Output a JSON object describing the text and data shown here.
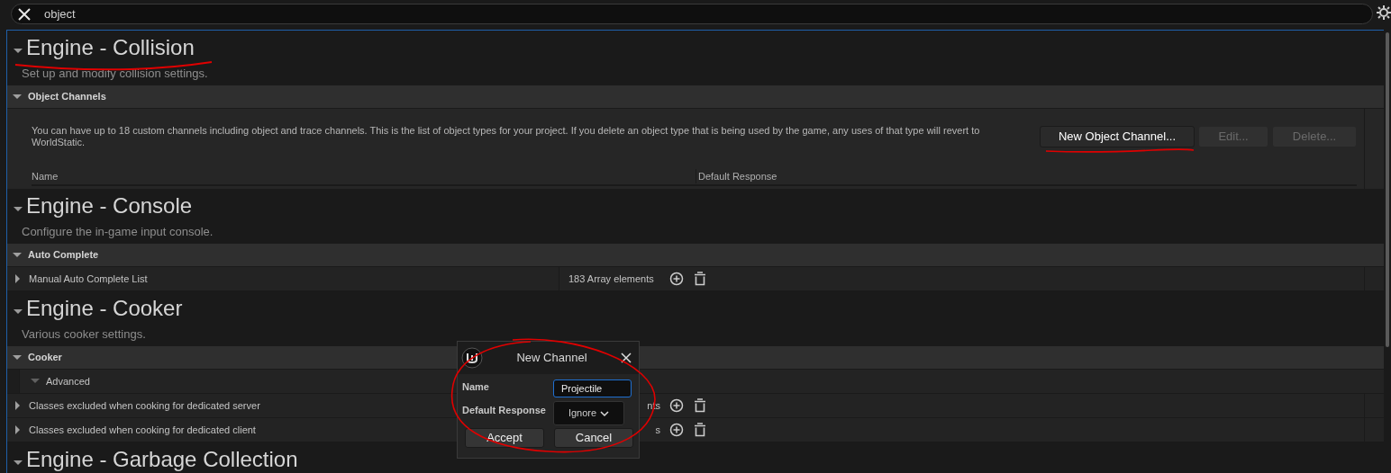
{
  "search": {
    "value": "object"
  },
  "sections": [
    {
      "title": "Engine - Collision",
      "description": "Set up and modify collision settings.",
      "expanded": true,
      "underlined": true,
      "categories": [
        {
          "title": "Object Channels",
          "expanded": true,
          "kind": "channels",
          "note": "You can have up to 18 custom channels including object and trace channels. This is the list of object types for your project. If you delete an object type that is being used by the game, any uses of that type will revert to WorldStatic.",
          "buttons": [
            {
              "label": "New Object Channel...",
              "disabled": false,
              "underlined": true
            },
            {
              "label": "Edit...",
              "disabled": true,
              "underlined": false
            },
            {
              "label": "Delete...",
              "disabled": true,
              "underlined": false
            }
          ],
          "columns": [
            "Name",
            "Default Response"
          ]
        }
      ]
    },
    {
      "title": "Engine - Console",
      "description": "Configure the in-game input console.",
      "expanded": true,
      "underlined": false,
      "categories": [
        {
          "title": "Auto Complete",
          "expanded": true,
          "kind": "properties",
          "rows": [
            {
              "kind": "array",
              "name": "Manual Auto Complete List",
              "expanded": false,
              "value": "183 Array elements",
              "covered": false
            }
          ]
        }
      ]
    },
    {
      "title": "Engine - Cooker",
      "description": "Various cooker settings.",
      "expanded": true,
      "underlined": false,
      "categories": [
        {
          "title": "Cooker",
          "expanded": true,
          "kind": "properties",
          "rows": [
            {
              "kind": "group",
              "name": "Advanced",
              "expanded": true
            },
            {
              "kind": "array",
              "name": "Classes excluded when cooking for dedicated server",
              "expanded": false,
              "value": "nts",
              "covered": true
            },
            {
              "kind": "array",
              "name": "Classes excluded when cooking for dedicated client",
              "expanded": false,
              "value": "s",
              "covered": true
            }
          ]
        }
      ]
    },
    {
      "title": "Engine - Garbage Collection",
      "expanded": true,
      "underlined": false
    }
  ],
  "dialog": {
    "title": "New Channel",
    "circled": true,
    "fields": [
      {
        "label": "Name",
        "kind": "text",
        "value": "Projectile"
      },
      {
        "label": "Default Response",
        "kind": "dropdown",
        "value": "Ignore"
      }
    ],
    "buttons": [
      "Accept",
      "Cancel"
    ]
  }
}
